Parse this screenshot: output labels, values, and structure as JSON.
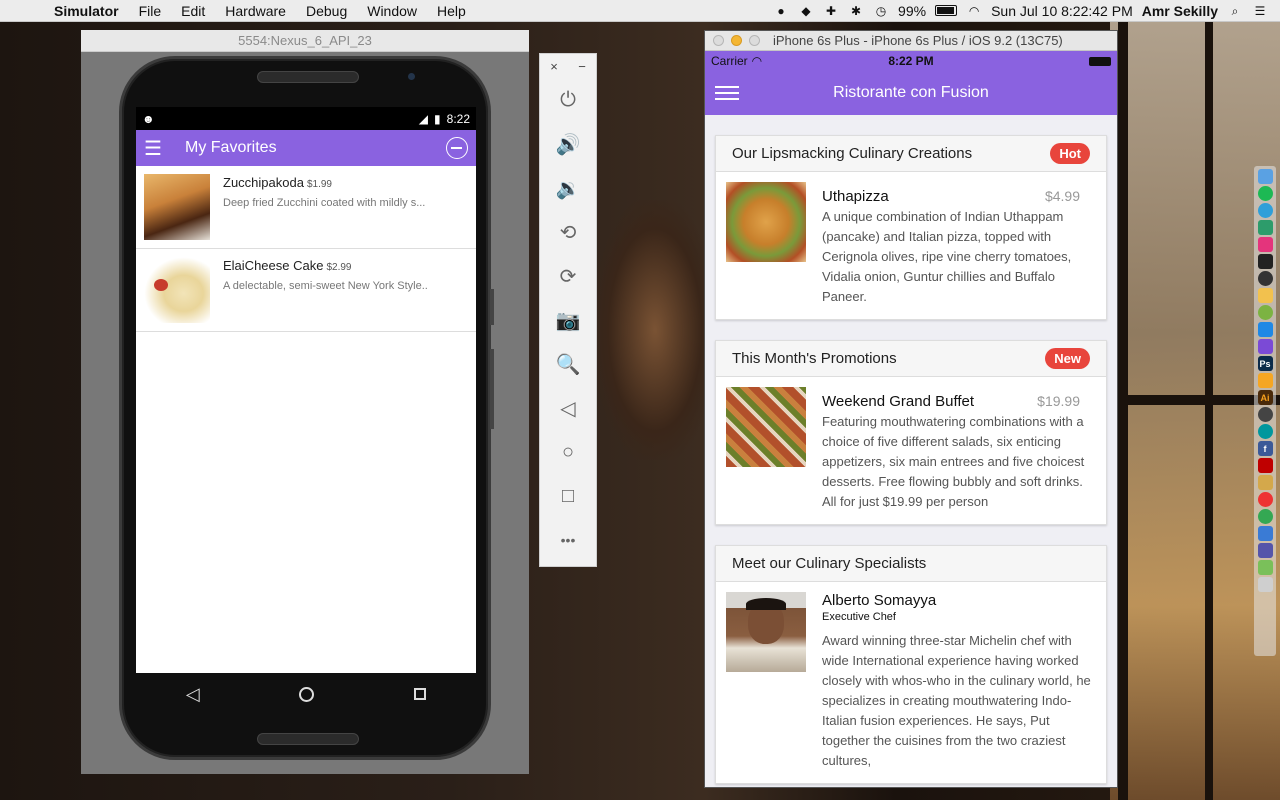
{
  "menubar": {
    "apple": "",
    "app": "Simulator",
    "items": [
      "File",
      "Edit",
      "Hardware",
      "Debug",
      "Window",
      "Help"
    ],
    "battery": "99%",
    "datetime": "Sun Jul 10  8:22:42 PM",
    "user": "Amr Sekilly"
  },
  "android": {
    "window_title": "5554:Nexus_6_API_23",
    "status_time": "8:22",
    "toolbar_title": "My Favorites",
    "items": [
      {
        "name": "Zucchipakoda",
        "price": "$1.99",
        "desc": "Deep fried Zucchini coated with mildly s..."
      },
      {
        "name": "ElaiCheese Cake",
        "price": "$2.99",
        "desc": "A delectable, semi-sweet New York Style.."
      }
    ]
  },
  "emulator_tools": {
    "close": "×",
    "minimize": "−",
    "icons": [
      "power-icon",
      "volume-up-icon",
      "volume-down-icon",
      "rotate-left-icon",
      "rotate-right-icon",
      "camera-icon",
      "zoom-icon",
      "back-icon",
      "home-icon",
      "overview-icon",
      "more-icon"
    ],
    "glyphs": [
      "⏻",
      "🔊",
      "🔉",
      "⟲",
      "⟳",
      "📷",
      "🔍",
      "◁",
      "○",
      "□",
      "•••"
    ]
  },
  "ios": {
    "window_title": "iPhone 6s Plus - iPhone 6s Plus / iOS 9.2 (13C75)",
    "carrier": "Carrier",
    "time": "8:22 PM",
    "nav_title": "Ristorante con Fusion",
    "cards": [
      {
        "header": "Our Lipsmacking Culinary Creations",
        "badge": "Hot",
        "title": "Uthapizza",
        "price": "$4.99",
        "desc": "A unique combination of Indian Uthappam (pancake) and Italian pizza, topped with Cerignola olives, ripe vine cherry tomatoes, Vidalia onion, Guntur chillies and Buffalo Paneer."
      },
      {
        "header": "This Month's Promotions",
        "badge": "New",
        "title": "Weekend Grand Buffet",
        "price": "$19.99",
        "desc": "Featuring mouthwatering combinations with a choice of five different salads, six enticing appetizers, six main entrees and five choicest desserts. Free flowing bubbly and soft drinks. All for just $19.99 per person"
      },
      {
        "header": "Meet our Culinary Specialists",
        "title": "Alberto Somayya",
        "subtitle": "Executive Chef",
        "desc": "Award winning three-star Michelin chef with wide International experience having worked closely with whos-who in the culinary world, he specializes in creating mouthwatering Indo-Italian fusion experiences. He says, Put together the cuisines from the two craziest cultures,"
      }
    ]
  },
  "colors": {
    "accent": "#8a62e0",
    "badge": "#e8453c"
  }
}
